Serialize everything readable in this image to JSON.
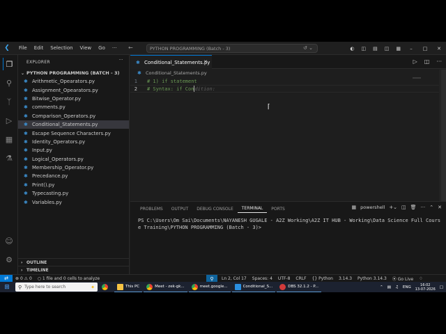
{
  "titlebar": {
    "menu": [
      "File",
      "Edit",
      "Selection",
      "View",
      "Go",
      "···"
    ],
    "command_center": "PYTHON PROGRAMMING (Batch - 3)"
  },
  "explorer": {
    "header": "EXPLORER",
    "folder": "PYTHON PROGRAMMING (BATCH - 3)",
    "files": [
      "Arithmetic_Opearators.py",
      "Assignment_Opearators.py",
      "Bitwise_Operator.py",
      "comments.py",
      "Comparison_Operators.py",
      "Conditional_Statements.py",
      "Escape Sequence Characters.py",
      "Identity_Operators.py",
      "Input.py",
      "Logical_Operators.py",
      "Membership_Operator.py",
      "Precedance.py",
      "Print().py",
      "Typecasting.py",
      "Variables.py"
    ],
    "selected_index": 5,
    "outline_label": "OUTLINE",
    "timeline_label": "TIMELINE"
  },
  "editor": {
    "tab_label": "Conditional_Statements.py",
    "breadcrumb": "Conditional_Statements.py",
    "lines": [
      {
        "number": "1",
        "text": "# 1) if statement",
        "ghost": ""
      },
      {
        "number": "2",
        "text": "# Syntax: if Con",
        "ghost": "dition:"
      }
    ]
  },
  "panel": {
    "tabs": [
      "PROBLEMS",
      "OUTPUT",
      "DEBUG CONSOLE",
      "TERMINAL",
      "PORTS"
    ],
    "active_tab": "TERMINAL",
    "shell": "powershell",
    "terminal_text": "PS C:\\Users\\Om Sai\\Documents\\NAYANESH GUGALE - A2Z Working\\A2Z IT HUB - Working\\Data Science Full Course Training\\PYTHON PROGRAMMING (Batch - 3)>"
  },
  "statusbar": {
    "problems": "0 ⚠ 0",
    "info": "1 file and 0 cells to analyze",
    "position": "Ln 2, Col 17",
    "spaces": "Spaces: 4",
    "encoding": "UTF-8",
    "eol": "CRLF",
    "language": "Python",
    "version_badge": "3.14.3",
    "interpreter": "Python 3.14.3",
    "golive": "Go Live"
  },
  "taskbar": {
    "search_placeholder": "Type here to search",
    "items": [
      "This PC",
      "Meet - zek-gk...",
      "meet.google...",
      "Conditional_S...",
      "DBS 32.1.2 - P..."
    ],
    "language": "ENG",
    "time": "16:02",
    "date": "13-07-2026"
  },
  "colors": {
    "accent": "#0078d4",
    "comment": "#6a9955",
    "python_icon": "#3c8fd0"
  }
}
